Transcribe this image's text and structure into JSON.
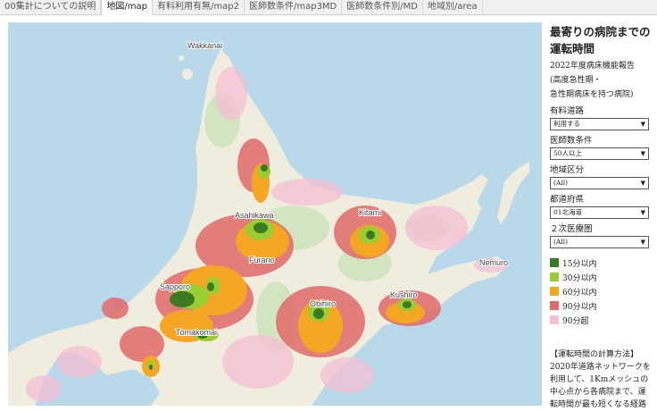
{
  "tabs": [
    {
      "label": "00集計についての説明",
      "active": false
    },
    {
      "label": "地図/map",
      "active": true
    },
    {
      "label": "有料利用有無/map2",
      "active": false
    },
    {
      "label": "医師数条件/map3MD",
      "active": false
    },
    {
      "label": "医師数条件別/MD",
      "active": false
    },
    {
      "label": "地域別/area",
      "active": false
    }
  ],
  "map": {
    "places": [
      "Wakkanai",
      "Asahikawa",
      "Furano",
      "Sapporo",
      "Tomakomai",
      "Kitami",
      "Obihiro",
      "Kushiro",
      "Nemuro"
    ],
    "colors": {
      "sea": "#b9d9eb",
      "land": "#f0eddf",
      "forest": "#d3e4c0"
    }
  },
  "sidebar": {
    "title": "最寄りの病院までの運転時間",
    "subtitle_lines": [
      "2022年度病床機能報告",
      "(高度急性期・",
      "急性期病床を持つ病院)"
    ],
    "filters": [
      {
        "label": "有料道路",
        "value": "利用する"
      },
      {
        "label": "医師数条件",
        "value": "50人以上"
      },
      {
        "label": "地域区分",
        "value": "(All)"
      },
      {
        "label": "都道府県",
        "value": "01北海道"
      },
      {
        "label": "２次医療圏",
        "value": "(All)"
      }
    ],
    "legend": [
      {
        "label": "15分以内",
        "color": "#3b7a23"
      },
      {
        "label": "30分以内",
        "color": "#9acd32"
      },
      {
        "label": "60分以内",
        "color": "#f5a623"
      },
      {
        "label": "90分以内",
        "color": "#e06a6a"
      },
      {
        "label": "90分超",
        "color": "#f6bfd3"
      }
    ],
    "note_lines": [
      "【運転時間の計算方法】",
      "2020年道路ネットワークを",
      "利用して、1Kmメッシュの",
      "中心点から各病院まで、運",
      "転時間が最も短くなる経路"
    ]
  }
}
